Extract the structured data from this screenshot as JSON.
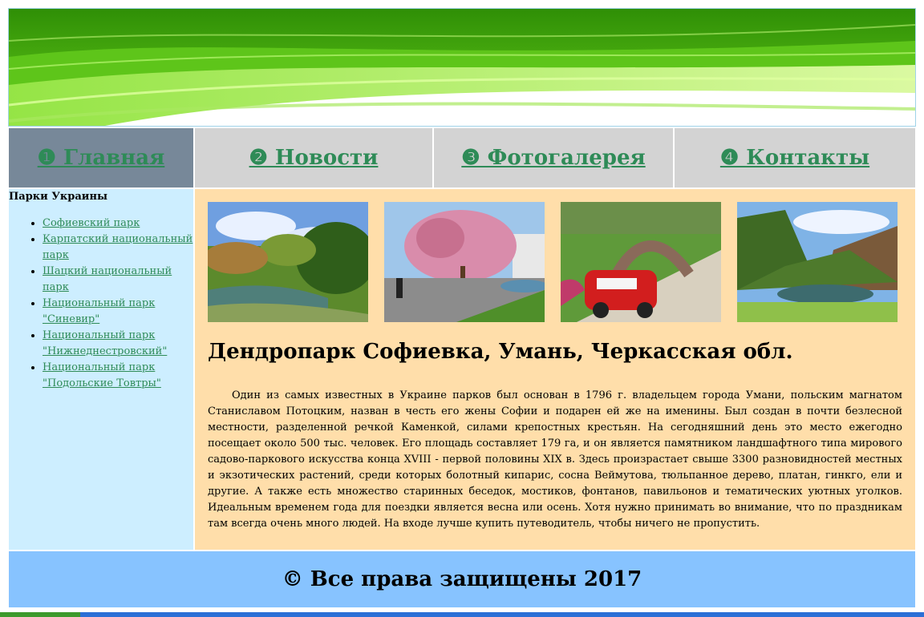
{
  "nav": {
    "items": [
      {
        "label": "❶ Главная"
      },
      {
        "label": "❷ Новости"
      },
      {
        "label": "❸ Фотогалерея"
      },
      {
        "label": "❹ Контакты"
      }
    ]
  },
  "sidebar": {
    "title": "Парки Украины",
    "items": [
      {
        "label": "Софиевский парк"
      },
      {
        "label": "Карпатский национальный парк"
      },
      {
        "label": "Шацкий национальный парк"
      },
      {
        "label": "Национальный парк \"Синевир\""
      },
      {
        "label": "Национальный парк \"Нижнеднестровский\""
      },
      {
        "label": "Национальный парк \"Подольские Товтры\""
      }
    ]
  },
  "main": {
    "heading": "Дендропарк Софиевка, Умань, Черкасская обл.",
    "paragraph": "Один из самых известных в Украине парков был основан в 1796 г. владельцем города Умани, польским магнатом Станиславом Потоцким, назван в честь его жены Софии и подарен ей же на именины. Был создан в почти безлесной местности, разделенной речкой Каменкой, силами крепостных крестьян. На сегодняшний день это место ежегодно посещает около 500 тыс. человек. Его площадь составляет 179 га, и он является памятником ландшафтного типа мирового садово-паркового искусства конца XVIII - первой половины XIX в. Здесь произрастает свыше 3300 разновидностей местных и экзотических растений, среди которых болотный кипарис, сосна Веймутова, тюльпанное дерево, платан, гинкго, ели и другие. А также есть множество старинных беседок, мостиков, фонтанов, павильонов и тематических уютных уголков. Идеальным временем года для поездки является весна или осень. Хотя нужно принимать во внимание, что по праздникам там всегда очень много людей. На входе лучше купить путеводитель, чтобы ничего не пропустить."
  },
  "footer": {
    "text": "© Все права защищены 2017"
  },
  "colors": {
    "nav_bg": "#d3d3d3",
    "nav_active_bg": "#778899",
    "link": "#2e8b57",
    "sidebar_bg": "#cdeeff",
    "content_bg": "#ffdeaa",
    "footer_bg": "#87c3ff"
  }
}
